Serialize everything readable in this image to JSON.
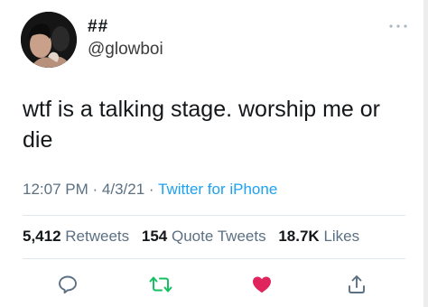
{
  "tweet": {
    "author": {
      "display_name": "##",
      "handle": "@glowboi"
    },
    "text_line1": "wtf is a talking stage. worship me or",
    "text_line2": "die",
    "time": "12:07 PM",
    "date": "4/3/21",
    "separator": "·",
    "source": "Twitter for iPhone",
    "stats": {
      "retweets_count": "5,412",
      "retweets_label": "Retweets",
      "quote_tweets_count": "154",
      "quote_tweets_label": "Quote Tweets",
      "likes_count": "18.7K",
      "likes_label": "Likes"
    },
    "liked": true
  },
  "colors": {
    "link": "#1da1f2",
    "secondary_text": "#5b7083",
    "retweet": "#17bf63",
    "like": "#e0245e"
  },
  "icons": [
    "more-icon",
    "reply-icon",
    "retweet-icon",
    "heart-icon",
    "share-icon"
  ]
}
